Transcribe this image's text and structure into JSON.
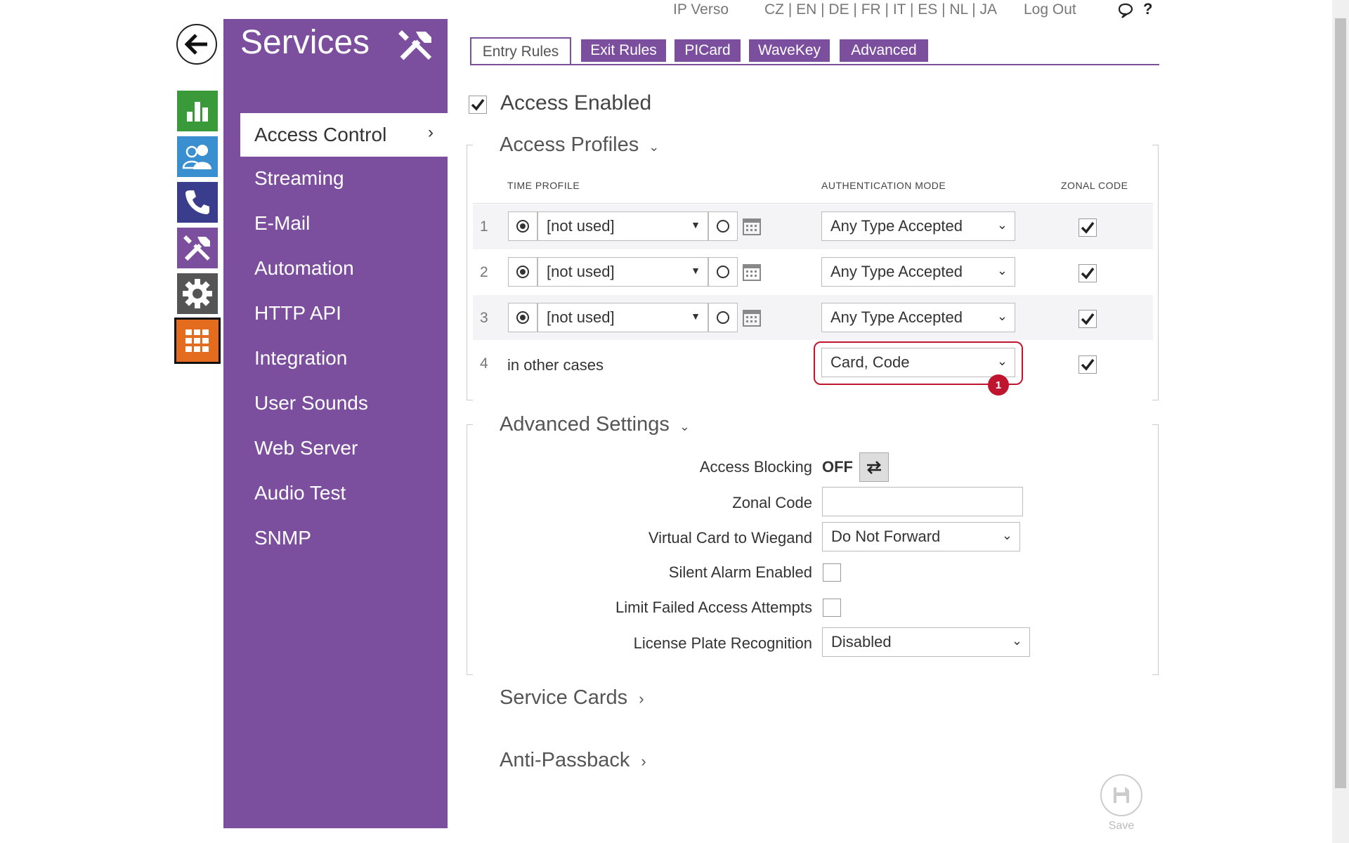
{
  "topbar": {
    "device": "IP Verso",
    "languages": "CZ | EN | DE | FR | IT | ES | NL | JA",
    "logout": "Log Out",
    "help": "?"
  },
  "sidebar": {
    "title": "Services",
    "items": [
      {
        "label": "Access Control"
      },
      {
        "label": "Streaming"
      },
      {
        "label": "E-Mail"
      },
      {
        "label": "Automation"
      },
      {
        "label": "HTTP API"
      },
      {
        "label": "Integration"
      },
      {
        "label": "User Sounds"
      },
      {
        "label": "Web Server"
      },
      {
        "label": "Audio Test"
      },
      {
        "label": "SNMP"
      }
    ]
  },
  "tabs": [
    {
      "label": "Entry Rules"
    },
    {
      "label": "Exit Rules"
    },
    {
      "label": "PICard"
    },
    {
      "label": "WaveKey"
    },
    {
      "label": "Advanced"
    }
  ],
  "access_enabled": {
    "label": "Access Enabled",
    "checked": true
  },
  "profiles": {
    "title": "Access Profiles",
    "col_time": "TIME PROFILE",
    "col_auth": "AUTHENTICATION MODE",
    "col_zonal": "ZONAL CODE",
    "rows": [
      {
        "num": "1",
        "time": "[not used]",
        "auth": "Any Type Accepted",
        "zonal": true
      },
      {
        "num": "2",
        "time": "[not used]",
        "auth": "Any Type Accepted",
        "zonal": true
      },
      {
        "num": "3",
        "time": "[not used]",
        "auth": "Any Type Accepted",
        "zonal": true
      },
      {
        "num": "4",
        "time": "in other cases",
        "auth": "Card, Code",
        "zonal": true
      }
    ],
    "badge": "1"
  },
  "advanced": {
    "title": "Advanced Settings",
    "access_blocking_label": "Access Blocking",
    "access_blocking_value": "OFF",
    "zonal_code_label": "Zonal Code",
    "zonal_code_value": "",
    "virtual_card_label": "Virtual Card to Wiegand",
    "virtual_card_value": "Do Not Forward",
    "silent_alarm_label": "Silent Alarm Enabled",
    "limit_failed_label": "Limit Failed Access Attempts",
    "lpr_label": "License Plate Recognition",
    "lpr_value": "Disabled"
  },
  "service_cards": {
    "title": "Service Cards"
  },
  "anti_passback": {
    "title": "Anti-Passback"
  },
  "save": {
    "label": "Save"
  },
  "colors": {
    "accent": "#7b4f9e",
    "green": "#3a9a3a",
    "blue": "#3a8fd0",
    "navy": "#3a3d8c",
    "gray": "#555555",
    "orange": "#e36c1f",
    "badge": "#c0152f"
  }
}
